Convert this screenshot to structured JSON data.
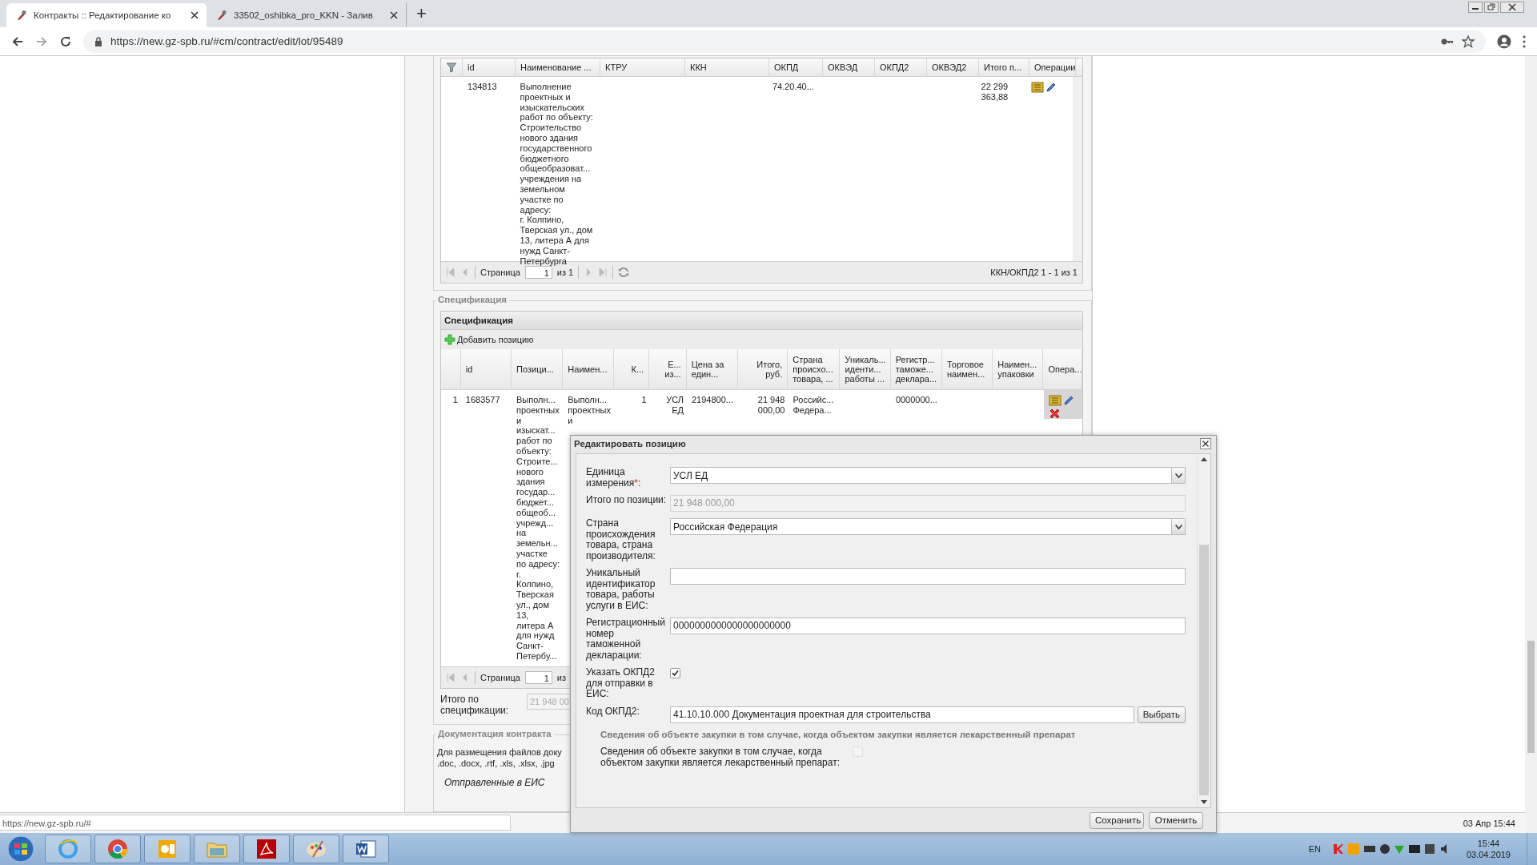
{
  "browser": {
    "tabs": [
      {
        "title": "Контракты :: Редактирование ко",
        "selected": true
      },
      {
        "title": "33502_oshibka_pro_KKN - Залив",
        "selected": false
      }
    ],
    "new_tab": "+",
    "url": "https://new.gz-spb.ru/#cm/contract/edit/lot/95489"
  },
  "kkn_table": {
    "columns": [
      "id",
      "Наименование ...",
      "КТРУ",
      "ККН",
      "ОКПД",
      "ОКВЭД",
      "ОКПД2",
      "ОКВЭД2",
      "Итого п...",
      "Операции"
    ],
    "rows": [
      {
        "cells": [
          "134813",
          "Выполнение\nпроектных и\nизыскательских\nработ по объекту:\nСтроительство\nнового здания\nгосударственного\nбюджетного\nобщеобразоват...\nучреждения на\nземельном\nучастке по адресу:\nг. Колпино,\nТверская ул., дом\n13, литера А для\nнужд Санкт-\nПетербурга",
          null,
          null,
          "74.20.40...",
          null,
          null,
          null,
          "22 299\n363,88"
        ]
      }
    ],
    "pager": {
      "page_label": "Страница",
      "page": "1",
      "of": "из 1",
      "summary": "ККН/ОКПД2 1 - 1 из 1"
    }
  },
  "specification": {
    "legend": "Спецификация",
    "title": "Спецификация",
    "add_button": "Добавить позицию",
    "columns": [
      "id",
      "Позици...",
      "Наимен...",
      "К...",
      "Е...\nиз...",
      "Цена за\nедин...",
      "Итого,\nруб.",
      "Страна\nпроисхо...\nтовара, ...",
      "Уникаль...\nиденти...\nработы ...",
      "Регистр...\nтаможе...\nдеклара...",
      "Торговое\nнаимен...",
      "Наимен...\nупаковки",
      "Опера..."
    ],
    "rows": [
      {
        "number": "1",
        "cells": [
          "1683577",
          "Выполн...\nпроектных\nи\nизыскат...\nработ по\nобъекту:\nСтроите...\nнового\nздания\nгосудар...\nбюджет...\nобщеоб...\nучрежд...\nна\nземельн...\nучастке\nпо адресу:\nг.\nКолпино,\nТверская\nул., дом\n13,\nлитера А\nдля нужд\nСанкт-\nПетербу...",
          "Выполн...\nпроектных\nи",
          "1",
          "УСЛ\nЕД",
          "2194800...",
          "21 948\n000,00",
          "Российс...\nФедера...",
          null,
          "0000000...",
          null,
          null
        ]
      }
    ],
    "pager": {
      "page_label": "Страница",
      "page": "1",
      "of": "из"
    },
    "total_label": "Итого по\nспецификации:",
    "total_value": "21 948 00"
  },
  "documents": {
    "legend": "Документация контракта",
    "text": "Для размещения файлов доку\n.doc, .docx, .rtf, .xls, .xlsx, .jpg",
    "sent_link": "Отправленные в ЕИС"
  },
  "dialog": {
    "title": "Редактировать позицию",
    "fields": [
      {
        "kind": "combo",
        "label": "Единица измерения",
        "required_mark": "*",
        "label_suffix": ":",
        "value": "УСЛ ЕД"
      },
      {
        "kind": "text",
        "label": "Итого по позиции:",
        "value": "21 948 000,00",
        "disabled": true
      },
      {
        "kind": "combo",
        "label": "Страна происхождения товара, страна производителя:",
        "value": "Российская Федерация"
      },
      {
        "kind": "text",
        "label": "Уникальный идентификатор товара, работы услуги в ЕИС:",
        "disabled": false
      },
      {
        "kind": "text",
        "label": "Регистрационный номер таможенной декларации:",
        "value": "0000000000000000000000",
        "disabled": false
      },
      {
        "kind": "checkbox",
        "label": "Указать ОКПД2 для отправки в ЕИС:",
        "checked": true
      },
      {
        "kind": "picker",
        "label": "Код ОКПД2:",
        "value": "41.10.10.000 Документация проектная для строительства",
        "button": "Выбрать"
      },
      {
        "kind": "heading",
        "label": "Сведения об объекте закупки в том случае, когда объектом закупки является лекарственный препарат"
      },
      {
        "kind": "wide_checkbox",
        "label": "Сведения об объекте закупки в том случае, когда объектом закупки является лекарственный препарат:",
        "checked": false
      }
    ],
    "buttons": [
      "Сохранить",
      "Отменить"
    ]
  },
  "status_url": "https://new.gz-spb.ru/#",
  "footer_time": "03 Апр 15:44",
  "taskbar": {
    "language": "EN",
    "time": "15:44",
    "date": "03.04.2019"
  }
}
